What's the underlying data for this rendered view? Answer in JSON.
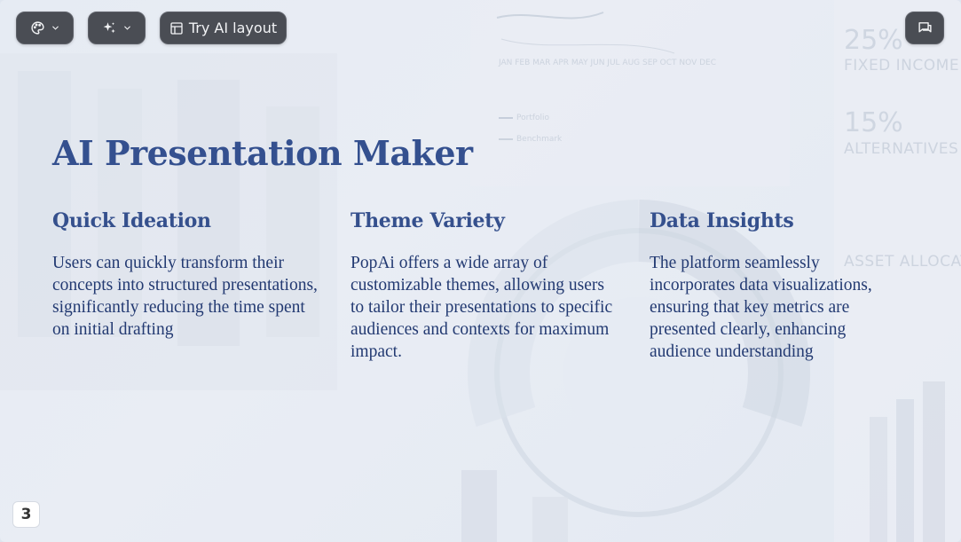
{
  "toolbar": {
    "theme_icon": "palette-icon",
    "ai_icon": "sparkles-icon",
    "layout_icon": "layout-icon",
    "try_ai_layout_label": "Try AI layout",
    "comment_icon": "comment-icon"
  },
  "slide": {
    "title": "AI Presentation Maker",
    "columns": [
      {
        "heading": "Quick Ideation",
        "body": "Users can quickly transform their concepts into structured presentations, significantly reducing the time spent on initial drafting"
      },
      {
        "heading": "Theme Variety",
        "body": "PopAi offers a wide array of customizable themes, allowing users to tailor their presentations to specific audiences and contexts for maximum impact."
      },
      {
        "heading": "Data Insights",
        "body": "The platform seamlessly incorporates data visualizations, ensuring that key metrics are presented clearly, enhancing audience understanding"
      }
    ],
    "page_number": "3"
  },
  "background": {
    "stat1_value": "25%",
    "stat1_label": "FIXED INCOME",
    "stat2_value": "15%",
    "stat2_label": "ALTERNATIVES",
    "allocation_label": "ASSET ALLOCATI",
    "legend_portfolio": "Portfolio",
    "legend_benchmark": "Benchmark",
    "months": "JAN   FEB   MAR   APR   MAY   JUN   JUL   AUG   SEP   OCT   NOV   DEC"
  },
  "colors": {
    "title": "#34508f",
    "body": "#233a72",
    "toolbar_bg": "#4a4d54"
  }
}
